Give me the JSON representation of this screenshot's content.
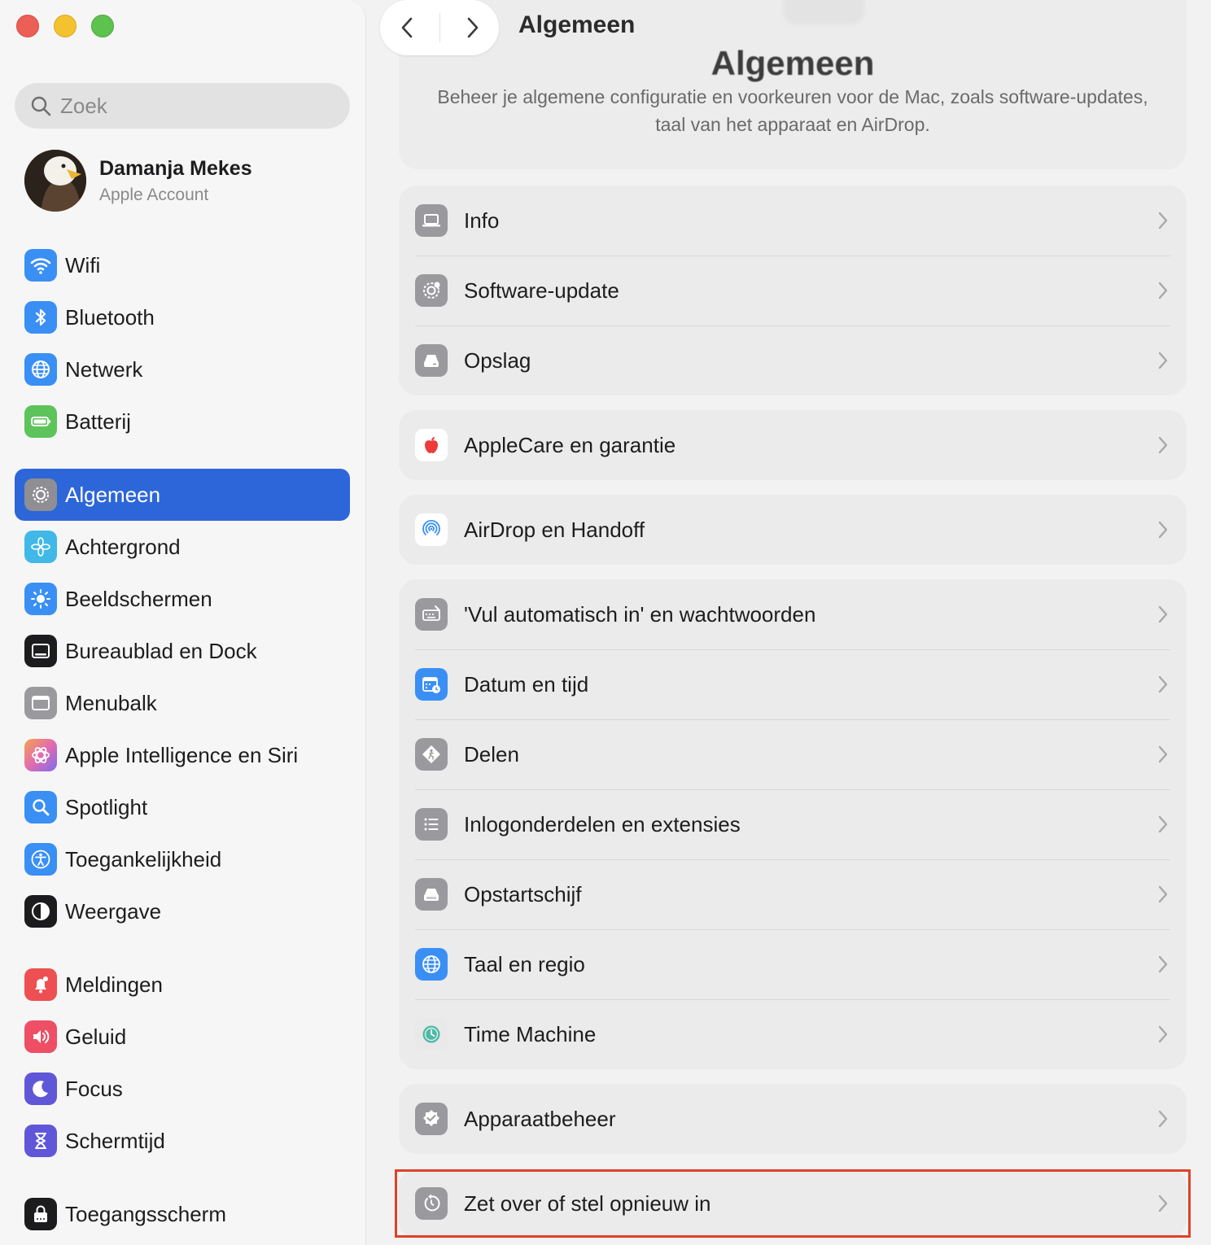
{
  "window": {
    "title": "Algemeen"
  },
  "search": {
    "placeholder": "Zoek"
  },
  "account": {
    "name": "Damanja Mekes",
    "subtitle": "Apple Account"
  },
  "sidebar": {
    "items": [
      {
        "label": "Wifi",
        "icon": "wifi-icon",
        "color": "#3a8ff5"
      },
      {
        "label": "Bluetooth",
        "icon": "bluetooth-icon",
        "color": "#3a8ff5"
      },
      {
        "label": "Netwerk",
        "icon": "globe-icon",
        "color": "#3a8ff5"
      },
      {
        "label": "Batterij",
        "icon": "battery-icon",
        "color": "#5cc45a"
      },
      {
        "label": "Algemeen",
        "icon": "gear-icon",
        "color": "#8e8e93",
        "active": true
      },
      {
        "label": "Achtergrond",
        "icon": "flower-icon",
        "color": "#40b8e8"
      },
      {
        "label": "Beeldschermen",
        "icon": "sun-icon",
        "color": "#3a8ff5"
      },
      {
        "label": "Bureaublad en Dock",
        "icon": "dock-icon",
        "color": "#1c1c1e"
      },
      {
        "label": "Menubalk",
        "icon": "menubar-icon",
        "color": "#9a9a9e"
      },
      {
        "label": "Apple Intelligence en Siri",
        "icon": "siri-icon",
        "color": "#e26bb0"
      },
      {
        "label": "Spotlight",
        "icon": "magnifier-icon",
        "color": "#3a8ff5"
      },
      {
        "label": "Toegankelijkheid",
        "icon": "accessibility-icon",
        "color": "#3a8ff5"
      },
      {
        "label": "Weergave",
        "icon": "appearance-icon",
        "color": "#1c1c1e"
      },
      {
        "label": "Meldingen",
        "icon": "bell-icon",
        "color": "#ee4f52"
      },
      {
        "label": "Geluid",
        "icon": "speaker-icon",
        "color": "#ee4f64"
      },
      {
        "label": "Focus",
        "icon": "moon-icon",
        "color": "#6057d8"
      },
      {
        "label": "Schermtijd",
        "icon": "hourglass-icon",
        "color": "#6057d8"
      },
      {
        "label": "Toegangsscherm",
        "icon": "lock-icon",
        "color": "#1c1c1e"
      }
    ]
  },
  "main": {
    "header": {
      "title": "Algemeen",
      "description": "Beheer je algemene configuratie en voorkeuren voor de Mac, zoals software-updates, taal van het apparaat en AirDrop."
    },
    "groups": [
      [
        {
          "label": "Info",
          "icon": "laptop-icon"
        },
        {
          "label": "Software-update",
          "icon": "gear-badge-icon"
        },
        {
          "label": "Opslag",
          "icon": "drive-icon"
        }
      ],
      [
        {
          "label": "AppleCare en garantie",
          "icon": "apple-icon"
        }
      ],
      [
        {
          "label": "AirDrop en Handoff",
          "icon": "airdrop-icon"
        }
      ],
      [
        {
          "label": "'Vul automatisch in' en wachtwoorden",
          "icon": "keyboard-icon"
        },
        {
          "label": "Datum en tijd",
          "icon": "calendar-clock-icon"
        },
        {
          "label": "Delen",
          "icon": "sharing-icon"
        },
        {
          "label": "Inlogonderdelen en extensies",
          "icon": "list-icon"
        },
        {
          "label": "Opstartschijf",
          "icon": "startup-disk-icon"
        },
        {
          "label": "Taal en regio",
          "icon": "language-globe-icon"
        },
        {
          "label": "Time Machine",
          "icon": "time-machine-icon"
        }
      ],
      [
        {
          "label": "Apparaatbeheer",
          "icon": "badge-check-icon"
        }
      ],
      [
        {
          "label": "Zet over of stel opnieuw in",
          "icon": "reset-icon"
        }
      ]
    ]
  },
  "colors": {
    "accent": "#2d66d8",
    "highlight": "#e0412a"
  }
}
